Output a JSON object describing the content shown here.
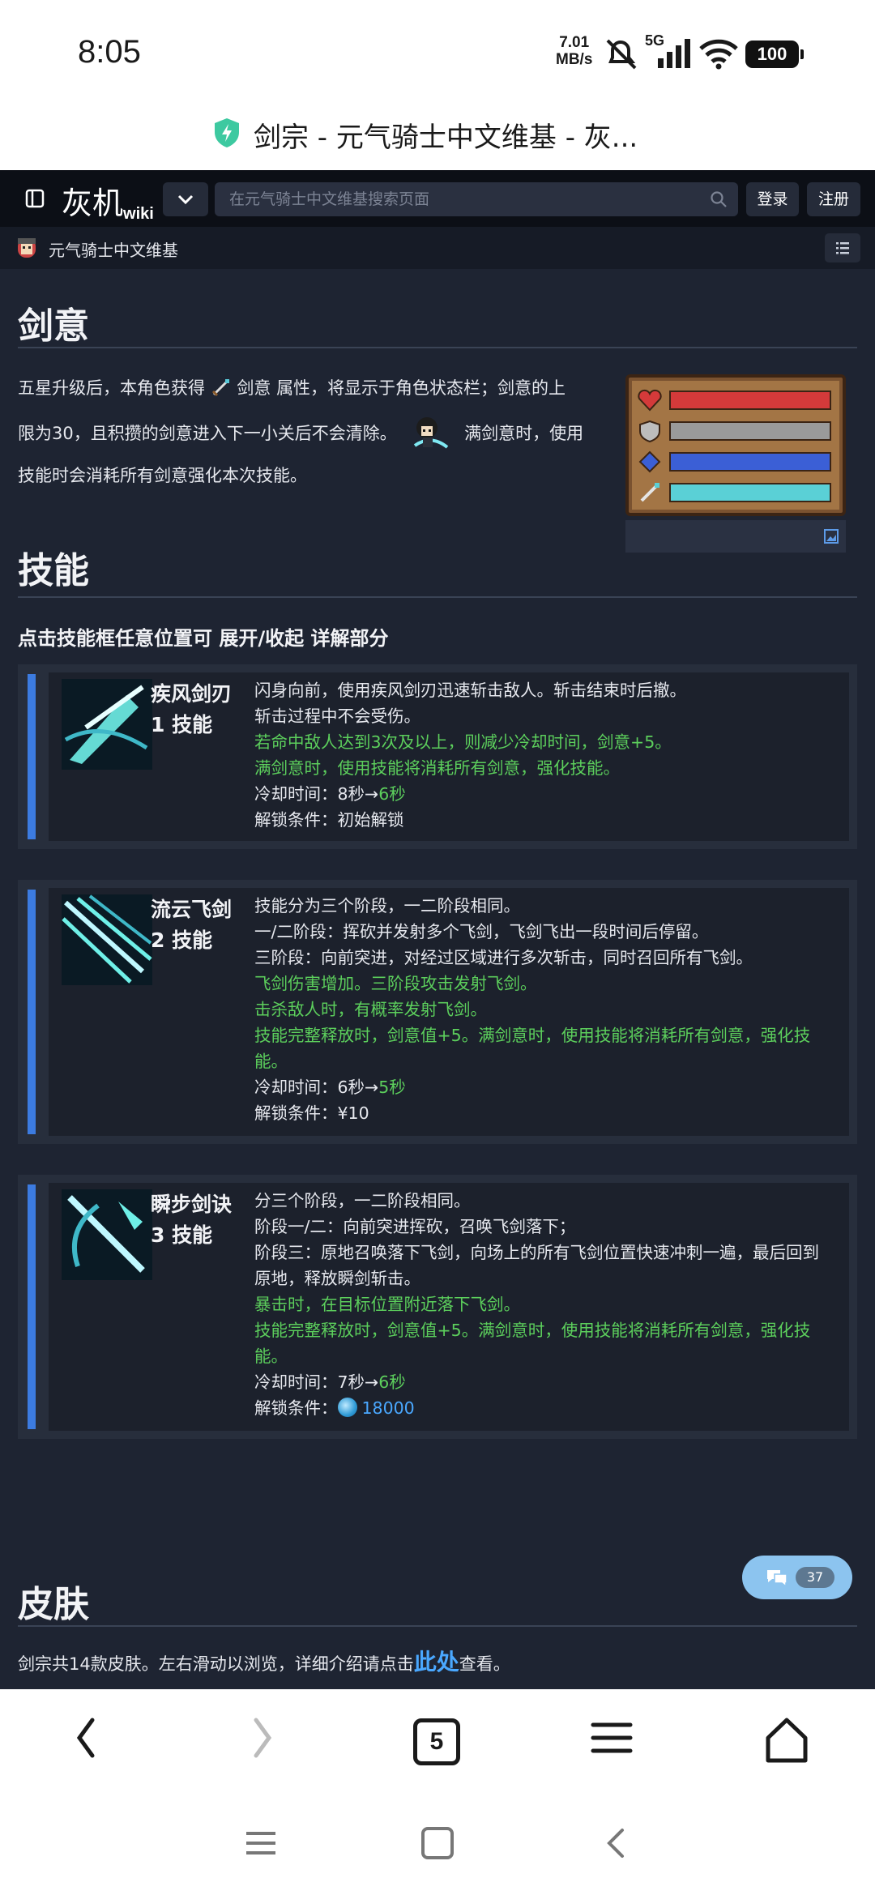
{
  "status_bar": {
    "time": "8:05",
    "rate_value": "7.01",
    "rate_unit": "MB/s",
    "network": "5G",
    "battery": "100"
  },
  "browser": {
    "page_title": "剑宗 - 元气骑士中文维基 - 灰..."
  },
  "site_header": {
    "logo_cn": "灰机",
    "logo_wiki": "wiki",
    "search_placeholder": "在元气骑士中文维基搜索页面",
    "login_label": "登录",
    "register_label": "注册"
  },
  "wiki_bar": {
    "name": "元气骑士中文维基"
  },
  "sections": {
    "sword_intent_title": "剑意",
    "sword_intent_line1_a": "五星升级后，本角色获得",
    "sword_intent_line1_b": "剑意",
    "sword_intent_line1_c": "属性，将显示于角色状态栏；剑意的上",
    "sword_intent_line2_a": "限为30，且积攒的剑意进入下一小关后不会清除。",
    "sword_intent_line2_b": "满剑意时，使用",
    "sword_intent_line3": "技能时会消耗所有剑意强化本次技能。",
    "skills_title": "技能",
    "skills_tip": "点击技能框任意位置可 展开/收起 详解部分",
    "skins_title": "皮肤",
    "skins_text_a": "剑宗共14款皮肤。左右滑动以浏览，详细介绍请点击",
    "skins_link": "此处",
    "skins_text_b": "查看。"
  },
  "stat_colors": {
    "hp": "#d43a3a",
    "armor": "#9a9a9a",
    "energy": "#3b5fd6",
    "sword_intent": "#5ad0d6"
  },
  "skills": [
    {
      "name": "疾风剑刃",
      "tag": "1 技能",
      "lines": [
        {
          "text": "闪身向前，使用疾风剑刃迅速斩击敌人。斩击结束时后撤。",
          "green": false
        },
        {
          "text": "斩击过程中不会受伤。",
          "green": false
        },
        {
          "text": "若命中敌人达到3次及以上，则减少冷却时间，剑意+5。",
          "green": true
        },
        {
          "text": "满剑意时，使用技能将消耗所有剑意，强化技能。",
          "green": true
        }
      ],
      "cooldown_label": "冷却时间：8秒→",
      "cooldown_value": "6秒",
      "unlock_label": "解锁条件：",
      "unlock_value": "初始解锁"
    },
    {
      "name": "流云飞剑",
      "tag": "2 技能",
      "lines": [
        {
          "text": "技能分为三个阶段，一二阶段相同。",
          "green": false
        },
        {
          "text": "一/二阶段：挥砍并发射多个飞剑，飞剑飞出一段时间后停留。",
          "green": false
        },
        {
          "text": "三阶段：向前突进，对经过区域进行多次斩击，同时召回所有飞剑。",
          "green": false
        },
        {
          "text": "飞剑伤害增加。三阶段攻击发射飞剑。",
          "green": true
        },
        {
          "text": "击杀敌人时，有概率发射飞剑。",
          "green": true
        },
        {
          "text": "技能完整释放时，剑意值+5。满剑意时，使用技能将消耗所有剑意，强化技能。",
          "green": true
        }
      ],
      "cooldown_label": "冷却时间：6秒→",
      "cooldown_value": "5秒",
      "unlock_label": "解锁条件：",
      "unlock_value": "¥10"
    },
    {
      "name": "瞬步剑诀",
      "tag": "3 技能",
      "lines": [
        {
          "text": "分三个阶段，一二阶段相同。",
          "green": false
        },
        {
          "text": "阶段一/二：向前突进挥砍，召唤飞剑落下；",
          "green": false
        },
        {
          "text": "阶段三：原地召唤落下飞剑，向场上的所有飞剑位置快速冲刺一遍，最后回到原地，释放瞬剑斩击。",
          "green": false
        },
        {
          "text": "暴击时，在目标位置附近落下飞剑。",
          "green": true
        },
        {
          "text": "技能完整释放时，剑意值+5。满剑意时，使用技能将消耗所有剑意，强化技能。",
          "green": true
        }
      ],
      "cooldown_label": "冷却时间：7秒→",
      "cooldown_value": "6秒",
      "unlock_label": "解锁条件：",
      "unlock_value": "18000"
    }
  ],
  "chat": {
    "count": "37"
  },
  "browser_nav": {
    "tabs_count": "5"
  }
}
